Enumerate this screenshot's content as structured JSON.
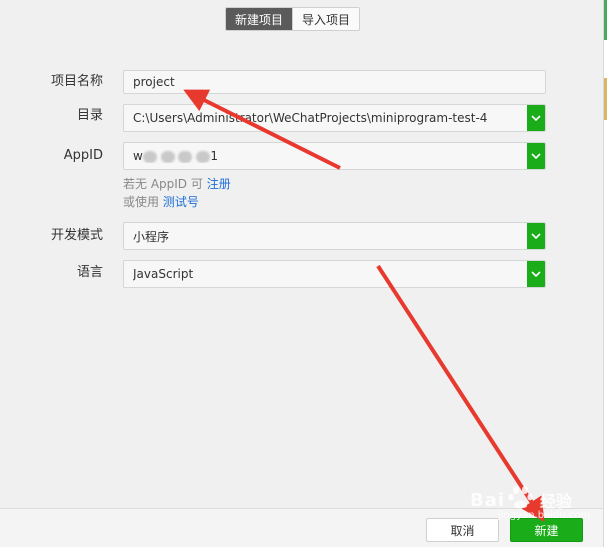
{
  "tabs": [
    {
      "label": "新建项目",
      "active": true
    },
    {
      "label": "导入项目",
      "active": false
    }
  ],
  "form": {
    "name_label": "项目名称",
    "name_value": "project",
    "dir_label": "目录",
    "dir_value": "C:\\Users\\Administrator\\WeChatProjects\\miniprogram-test-4",
    "appid_label": "AppID",
    "appid_value_start": "w",
    "appid_value_end": "1",
    "appid_hint_prefix": "若无 AppID 可",
    "appid_hint_link": "注册",
    "appid_hint2_prefix": "或使用",
    "appid_hint2_link": "测试号",
    "mode_label": "开发模式",
    "mode_value": "小程序",
    "lang_label": "语言",
    "lang_value": "JavaScript"
  },
  "buttons": {
    "cancel": "取消",
    "create": "新建"
  },
  "watermark": {
    "brand": "Bai",
    "jingyan": "经验",
    "url": "jingyan.baidu.com"
  },
  "colors": {
    "accent_green": "#1aad19",
    "active_tab": "#5b5b5b",
    "link_blue": "#1e6fd9",
    "annotation_red": "#e8392e"
  },
  "icons": [
    "chevron-down-icon",
    "annotation-arrow",
    "baidu-paw-icon"
  ]
}
